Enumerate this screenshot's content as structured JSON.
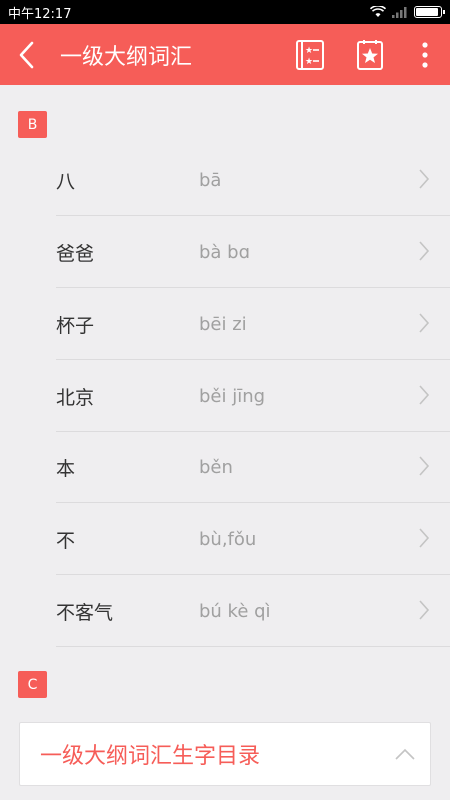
{
  "status_bar": {
    "time": "中午12:17"
  },
  "app_bar": {
    "title": "一级大纲词汇",
    "back_icon": "back-arrow-icon",
    "action1_icon": "star-list-icon",
    "action2_icon": "star-card-icon",
    "more_icon": "more-vertical-icon"
  },
  "colors": {
    "accent": "#f65d58",
    "background": "#efeef0"
  },
  "sections": [
    {
      "letter": "B"
    },
    {
      "letter": "C"
    }
  ],
  "words": [
    {
      "hanzi": "八",
      "pinyin": "bā"
    },
    {
      "hanzi": "爸爸",
      "pinyin": "bà bɑ"
    },
    {
      "hanzi": "杯子",
      "pinyin": "bēi zi"
    },
    {
      "hanzi": "北京",
      "pinyin": "běi jīng"
    },
    {
      "hanzi": "本",
      "pinyin": "běn"
    },
    {
      "hanzi": "不",
      "pinyin": "bù,fǒu"
    },
    {
      "hanzi": "不客气",
      "pinyin": "bú kè qì"
    }
  ],
  "catalog_dropdown": {
    "label": "一级大纲词汇生字目录"
  }
}
